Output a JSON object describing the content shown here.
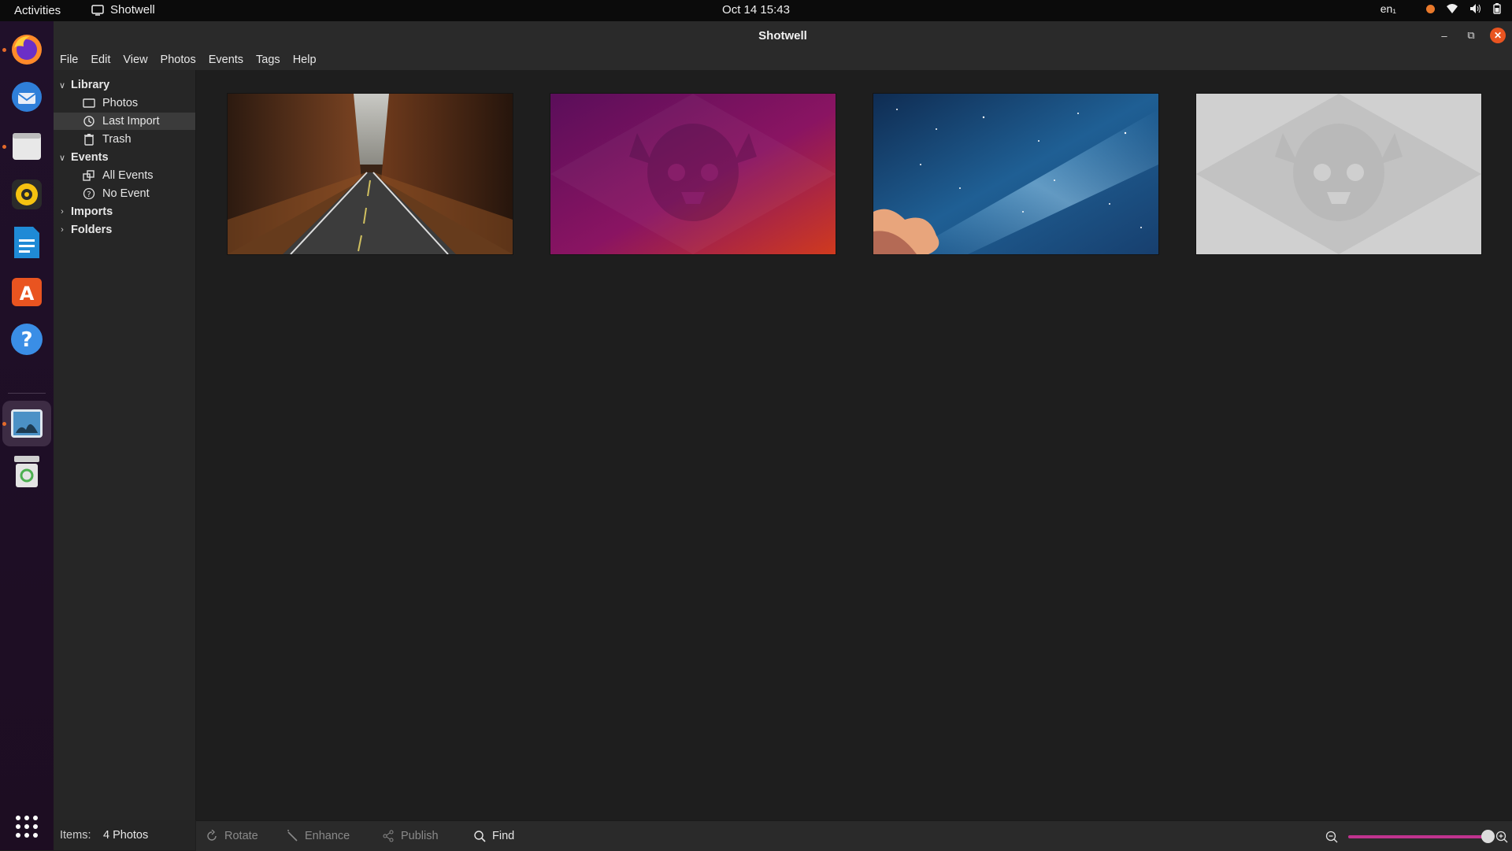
{
  "topbar": {
    "activities": "Activities",
    "app_name": "Shotwell",
    "clock": "Oct 14  15:43",
    "lang": "en₁"
  },
  "dock": {
    "apps": [
      "firefox-icon",
      "thunderbird-icon",
      "files-icon",
      "rhythmbox-icon",
      "writer-icon",
      "app-center-icon",
      "help-icon",
      "shotwell-icon",
      "trash-icon"
    ],
    "grid_icon": "show-apps-icon"
  },
  "window": {
    "title": "Shotwell",
    "menu": [
      "File",
      "Edit",
      "View",
      "Photos",
      "Events",
      "Tags",
      "Help"
    ]
  },
  "sidebar": {
    "library": "Library",
    "photos": "Photos",
    "last_import": "Last Import",
    "trash": "Trash",
    "events": "Events",
    "all_events": "All Events",
    "no_event": "No Event",
    "imports": "Imports",
    "folders": "Folders"
  },
  "status": {
    "items_label": "Items:",
    "items_value": "4 Photos"
  },
  "toolbar": {
    "rotate": "Rotate",
    "enhance": "Enhance",
    "publish": "Publish",
    "find": "Find"
  },
  "photos": [
    {
      "name": "autumn-road"
    },
    {
      "name": "ubuntu-purple-wallpaper"
    },
    {
      "name": "milky-way"
    },
    {
      "name": "ubuntu-gray-wallpaper"
    }
  ],
  "colors": {
    "accent": "#e95420",
    "zoom_track": "#c0338f"
  }
}
